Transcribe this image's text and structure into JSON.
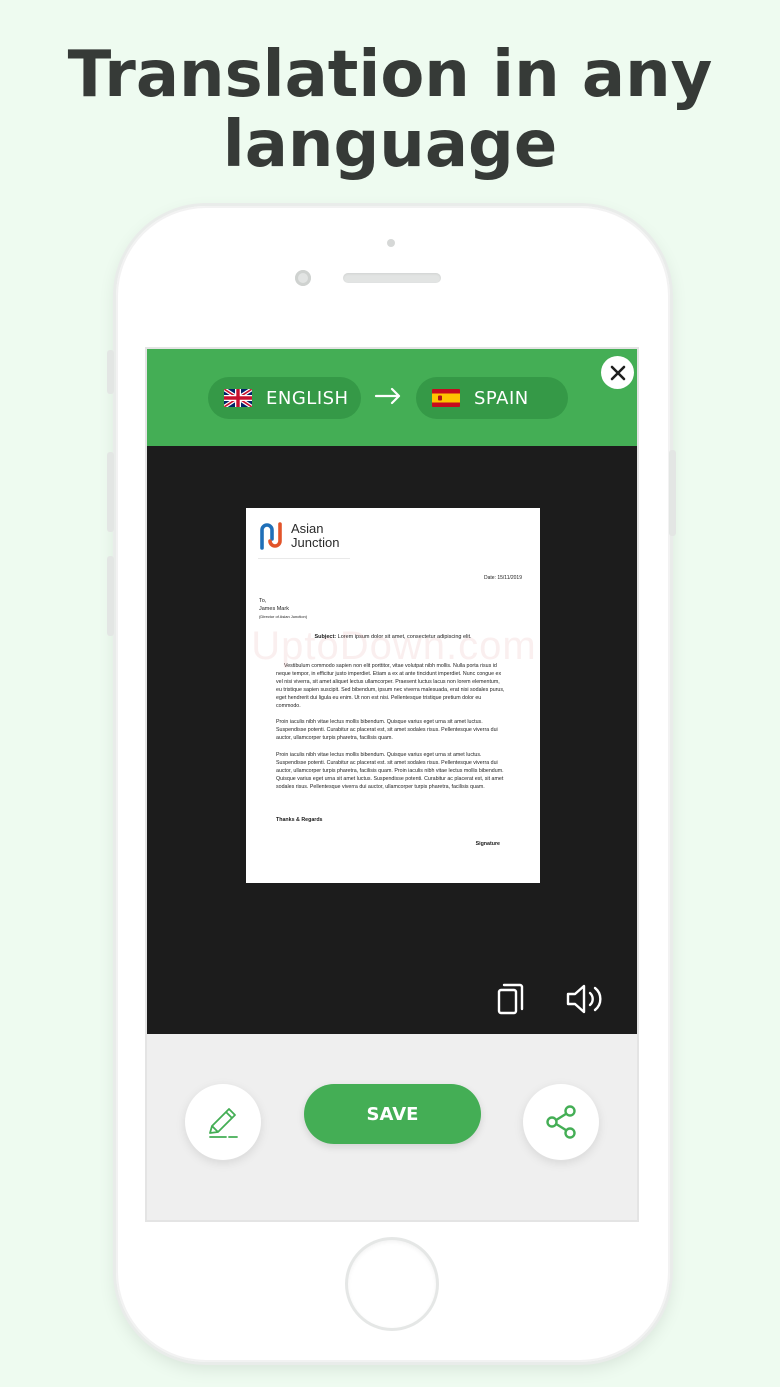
{
  "headline": {
    "line1": "Translation in any",
    "line2": "language"
  },
  "translator": {
    "source_language": "ENGLISH",
    "source_flag": "uk-flag-icon",
    "target_language": "SPAIN",
    "target_flag": "spain-flag-icon",
    "arrow": "arrow-right-icon",
    "close": "close-icon"
  },
  "document": {
    "brand_line1": "Asian",
    "brand_line2": "Junction",
    "date": "Date:    15/11/2019",
    "to_label": "To,",
    "to_name": "James Mark",
    "to_title": "(Director of Asian Junction)",
    "subject_label": "Subject:",
    "subject_text": " Lorem ipsum dolor sit amet, consectetur adipiscing elit.",
    "para1": "Vestibulum commodo sapien non elit porttitor, vitae volutpat nibh mollis. Nulla porta risus id neque tempor, in efficitur justo imperdiet. Etiam a ex at ante tincidunt imperdiet. Nunc congue ex vel nisi viverra, sit amet aliquet lectus ullamcorper. Praesent luctus lacus non lorem elementum, eu tristique sapien suscipit. Sed bibendum, ipsum nec viverra malesuada, erat nisi sodales purus, eget hendrerit dui ligula eu enim. Ut non est nisi. Pellentesque tristique pretium dolor eu commodo.",
    "para2": "Proin iaculis nibh vitae lectus mollis bibendum. Quisque varius eget urna sit amet luctus. Suspendisse potenti. Curabitur ac placerat est, sit amet sodales risus. Pellentesque viverra dui auctor, ullamcorper turpis pharetra, facilisis quam.",
    "para3": "Proin iaculis nibh vitae lectus mollis bibendum. Quisque varius eget urna st amet luctus. Suspendisse potenti. Curabitur ac placerat est. sit amet sodales risus. Pellentesque viverra dui auctor, ullamcorper turpis pharetra, facilisis quam. Proin iaculis nibh vitae lectus mollis bibendum. Quisque varius eget urna sit amet luctus. Suspendisse potenti. Curabitur ac placerat est, sit amet sodales risus. Pellentesque viverra dui auctor, ullamcorper turpis pharetra, facilisis quam.",
    "thanks": "Thanks & Regards",
    "signature": "Signature",
    "watermark": "UptoDown.com"
  },
  "actions": {
    "copy": "copy-icon",
    "speak": "speaker-icon",
    "edit": "pencil-icon",
    "save_label": "SAVE",
    "share": "share-icon"
  },
  "colors": {
    "accent_green": "#44ae55",
    "pill_green": "#359947",
    "background": "#eefbf0",
    "headline": "#363a37"
  }
}
